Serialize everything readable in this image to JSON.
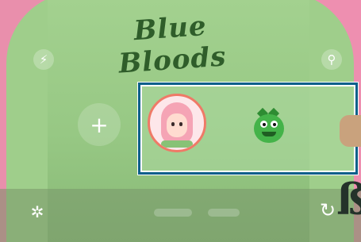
{
  "scene": {
    "sweater_text": "Blue Bloods",
    "sweater_color": "#9fce8b",
    "background_color": "#e889a9"
  },
  "top_controls": {
    "left_icon": "flash-icon",
    "left_glyph": "⚡",
    "right_icon": "person-icon",
    "right_glyph": "⚲"
  },
  "avatar_picker": {
    "add_glyph": "+",
    "highlight_color": "#0b5f8a",
    "items": [
      {
        "name": "pink-haired-girl-avatar",
        "selected": true
      },
      {
        "name": "green-dinosaur-avatar",
        "selected": false
      },
      {
        "name": "partial-avatar",
        "selected": false
      }
    ]
  },
  "bottom_bar": {
    "settings_glyph": "✲",
    "rotate_glyph": "↻"
  }
}
